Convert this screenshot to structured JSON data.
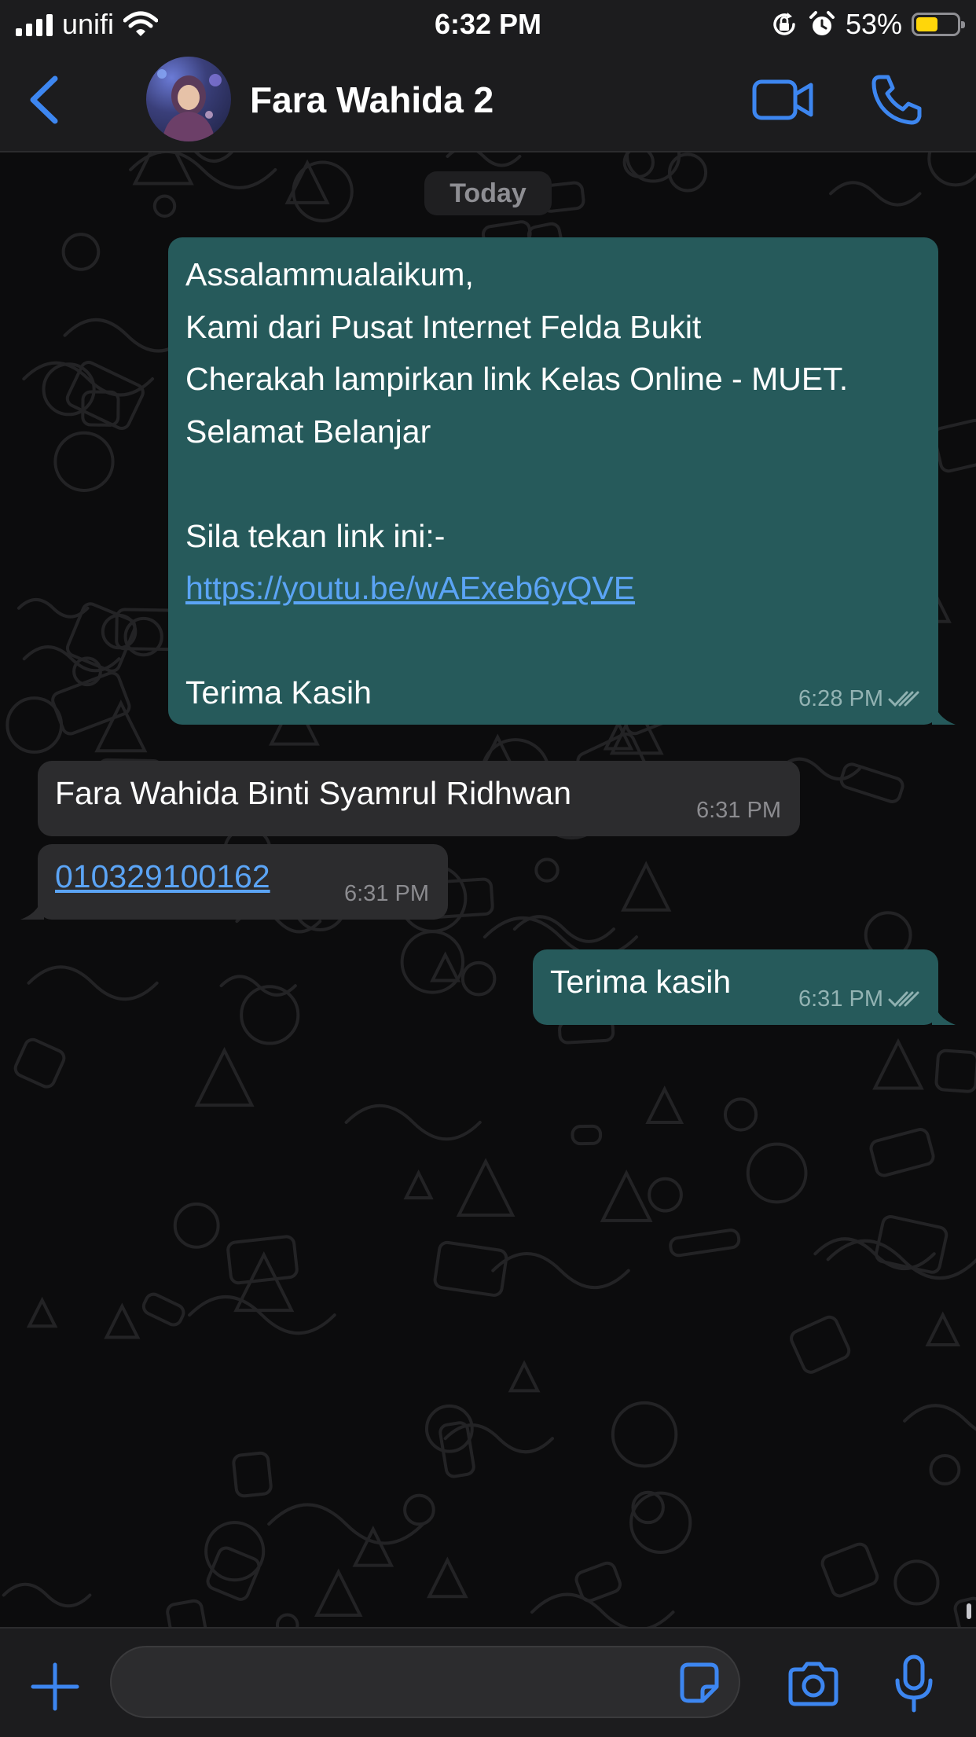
{
  "status_bar": {
    "carrier": "unifi",
    "time": "6:32 PM",
    "battery_percent": "53%",
    "battery_level": 0.53,
    "battery_color": "#ffd60a",
    "icons": [
      "signal-icon",
      "wifi-icon",
      "orientation-lock-icon",
      "alarm-icon",
      "battery-icon"
    ]
  },
  "header": {
    "contact_name": "Fara Wahida 2",
    "icons": [
      "back-chevron-icon",
      "avatar",
      "video-call-icon",
      "phone-icon"
    ],
    "accent_color": "#3d86f0"
  },
  "chat": {
    "date_label": "Today",
    "messages": [
      {
        "direction": "outgoing",
        "lines": [
          "Assalammualaikum,",
          "Kami dari Pusat Internet Felda Bukit",
          "Cherakah lampirkan link Kelas Online - MUET.",
          "Selamat Belanjar",
          "",
          "Sila tekan link ini:-",
          "https://youtu.be/wAExeb6yQVE",
          "",
          "Terima Kasih"
        ],
        "link_line_index": 6,
        "time": "6:28 PM",
        "status": "read-double-tick"
      },
      {
        "direction": "incoming",
        "text": "Fara Wahida Binti Syamrul Ridhwan",
        "time": "6:31 PM"
      },
      {
        "direction": "incoming",
        "text": "010329100162",
        "is_link": true,
        "time": "6:31 PM"
      },
      {
        "direction": "outgoing",
        "text": "Terima kasih",
        "time": "6:31 PM",
        "status": "read-double-tick"
      }
    ],
    "outgoing_bubble_color": "#265a5b",
    "incoming_bubble_color": "#2c2c2e",
    "link_color": "#5ba4f5"
  },
  "input_bar": {
    "value": "",
    "placeholder": "",
    "icons": [
      "plus-icon",
      "sticker-icon",
      "camera-icon",
      "microphone-icon"
    ]
  }
}
